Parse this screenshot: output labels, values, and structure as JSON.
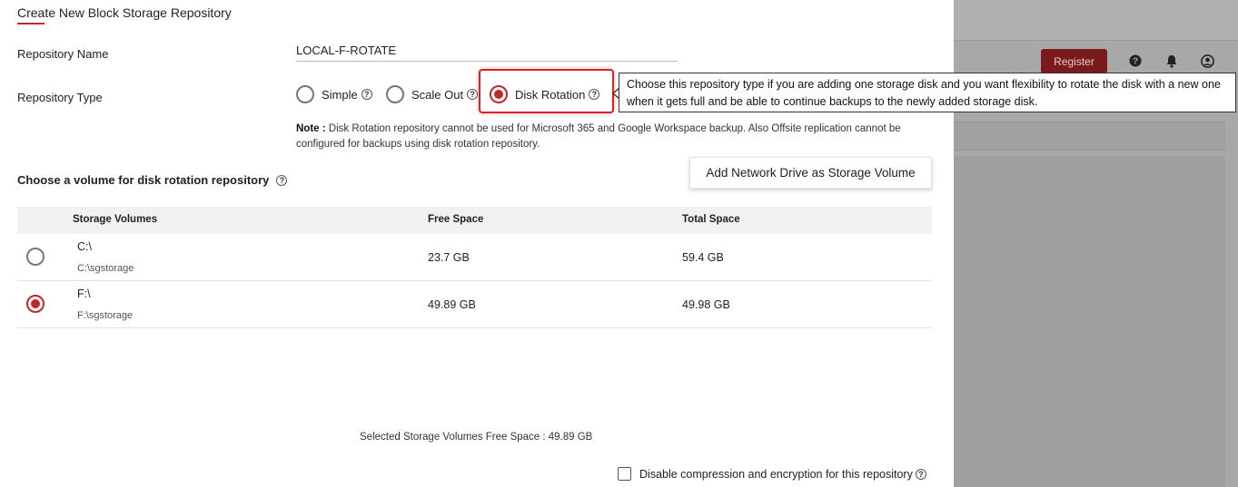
{
  "dialog": {
    "title": "Create New Block Storage Repository",
    "repository_name_label": "Repository Name",
    "repository_name_value": "LOCAL-F-ROTATE",
    "repository_type_label": "Repository Type",
    "types": [
      {
        "label": "Simple",
        "selected": false
      },
      {
        "label": "Scale Out",
        "selected": false
      },
      {
        "label": "Disk Rotation",
        "selected": true
      }
    ],
    "tooltip_text": "Choose this repository type if you are adding one storage disk and you want flexibility to rotate the disk with a new one when it gets full and be able to continue backups to the newly added storage disk.",
    "note_label": "Note :",
    "note_text": " Disk Rotation repository cannot be used for Microsoft 365 and Google Workspace backup. Also Offsite replication cannot be configured for backups using disk rotation repository.",
    "volume_section_title": "Choose a volume for disk rotation repository",
    "add_network_drive_label": "Add Network Drive as Storage Volume",
    "table": {
      "headers": {
        "volumes": "Storage Volumes",
        "free": "Free Space",
        "total": "Total Space"
      },
      "rows": [
        {
          "volume": "C:\\",
          "path": "C:\\sgstorage",
          "free": "23.7 GB",
          "total": "59.4 GB",
          "selected": false
        },
        {
          "volume": "F:\\",
          "path": "F:\\sgstorage",
          "free": "49.89 GB",
          "total": "49.98 GB",
          "selected": true
        }
      ]
    },
    "summary_text": "Selected Storage Volumes Free Space : 49.89 GB",
    "disable_compression_label": "Disable compression and encryption for this repository",
    "disable_compression_checked": false
  },
  "background": {
    "register_label": "Register",
    "icons": [
      "help-icon",
      "bell-icon",
      "user-icon"
    ]
  },
  "colors": {
    "accent": "#c0282d",
    "highlight": "#e02020",
    "overlay": "#a8a8a8"
  }
}
